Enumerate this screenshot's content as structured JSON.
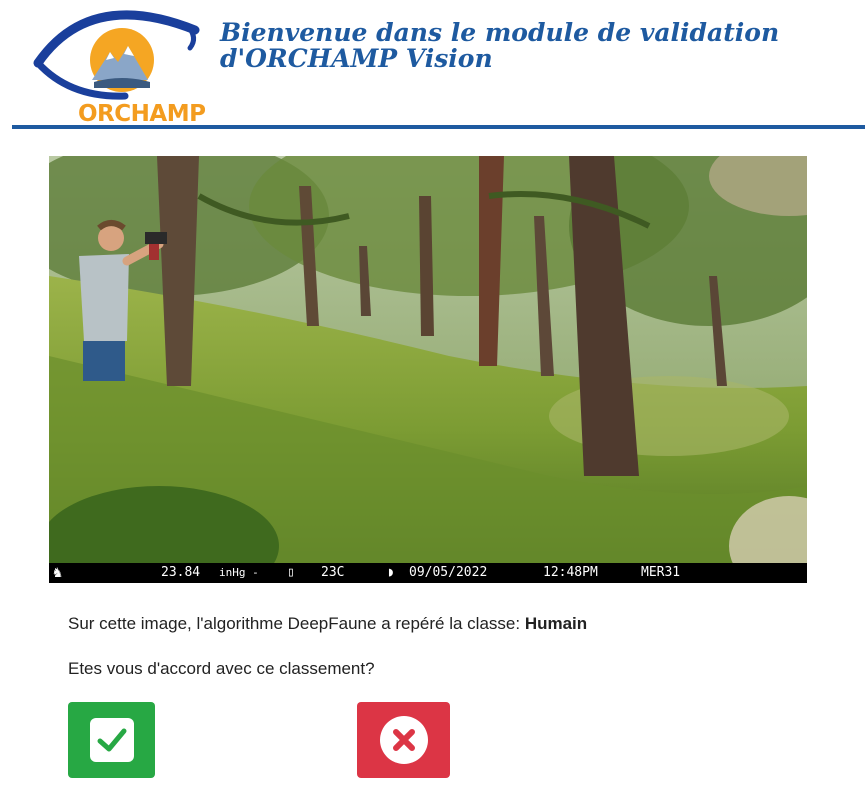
{
  "header": {
    "logo_text": "ORCHAMP",
    "title_line1": "Bienvenue dans le module de validation",
    "title_line2": "d'ORCHAMP Vision"
  },
  "image": {
    "stamp": {
      "pressure": "23.84",
      "pressure_unit": "inHg -",
      "temperature": "23C",
      "date": "09/05/2022",
      "time": "12:48PM",
      "camera_id": "MER31"
    }
  },
  "question": {
    "prefix": "Sur cette image, l'algorithme DeepFaune a repéré la classe: ",
    "detected_class": "Humain",
    "prompt": "Etes vous d'accord avec ce classement?"
  },
  "buttons": {
    "agree_icon": "check-square-icon",
    "disagree_icon": "times-circle-icon"
  },
  "colors": {
    "brand_blue": "#1e5aa0",
    "brand_orange": "#f39c1f",
    "agree": "#27a844",
    "disagree": "#dc3545"
  }
}
